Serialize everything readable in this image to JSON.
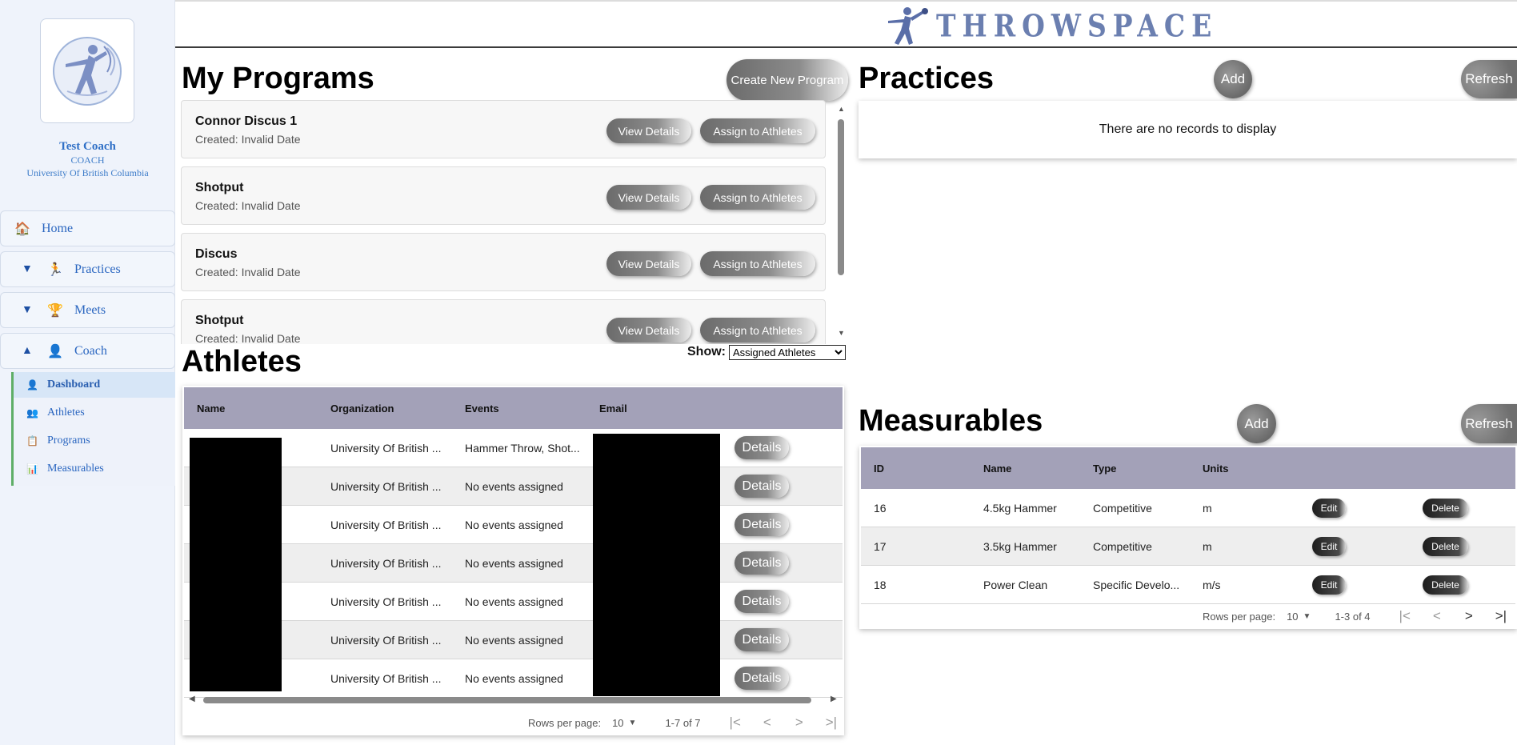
{
  "app": {
    "logo_text": "THROWSPACE"
  },
  "profile": {
    "name": "Test Coach",
    "role": "COACH",
    "organization": "University Of British Columbia"
  },
  "nav": {
    "home": "Home",
    "practices": "Practices",
    "meets": "Meets",
    "coach": "Coach",
    "caret_collapsed": "▼",
    "caret_expanded": "▲",
    "sub": {
      "dashboard": "Dashboard",
      "athletes": "Athletes",
      "programs": "Programs",
      "measurables": "Measurables"
    }
  },
  "programs": {
    "title": "My Programs",
    "create_label": "Create New Program",
    "view_label": "View Details",
    "assign_label": "Assign to Athletes",
    "items": [
      {
        "name": "Connor Discus 1",
        "created": "Created: Invalid Date"
      },
      {
        "name": "Shotput",
        "created": "Created: Invalid Date"
      },
      {
        "name": "Discus",
        "created": "Created: Invalid Date"
      },
      {
        "name": "Shotput",
        "created": "Created: Invalid Date"
      }
    ]
  },
  "practices": {
    "title": "Practices",
    "add_label": "Add",
    "refresh_label": "Refresh",
    "empty_text": "There are no records to display"
  },
  "athletes": {
    "title": "Athletes",
    "show_label": "Show:",
    "show_value": "Assigned Athletes",
    "columns": [
      "Name",
      "Organization",
      "Events",
      "Email"
    ],
    "details_label": "Details",
    "rows": [
      {
        "organization": "University Of British ...",
        "events": "Hammer Throw, Shot..."
      },
      {
        "organization": "University Of British ...",
        "events": "No events assigned"
      },
      {
        "organization": "University Of British ...",
        "events": "No events assigned"
      },
      {
        "organization": "University Of British ...",
        "events": "No events assigned"
      },
      {
        "organization": "University Of British ...",
        "events": "No events assigned"
      },
      {
        "organization": "University Of British ...",
        "events": "No events assigned"
      },
      {
        "organization": "University Of British ...",
        "events": "No events assigned"
      }
    ],
    "pager": {
      "rows_label": "Rows per page:",
      "rows_value": "10",
      "range": "1-7 of 7"
    }
  },
  "measurables": {
    "title": "Measurables",
    "add_label": "Add",
    "refresh_label": "Refresh",
    "columns": [
      "ID",
      "Name",
      "Type",
      "Units"
    ],
    "edit_label": "Edit",
    "delete_label": "Delete",
    "rows": [
      {
        "id": "16",
        "name": "4.5kg Hammer",
        "type": "Competitive",
        "units": "m"
      },
      {
        "id": "17",
        "name": "3.5kg Hammer",
        "type": "Competitive",
        "units": "m"
      },
      {
        "id": "18",
        "name": "Power Clean",
        "type": "Specific Develo...",
        "units": "m/s"
      }
    ],
    "pager": {
      "rows_label": "Rows per page:",
      "rows_value": "10",
      "range": "1-3 of 4"
    }
  }
}
